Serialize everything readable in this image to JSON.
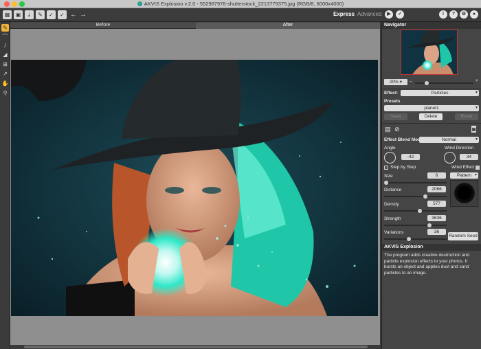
{
  "window": {
    "title": "AKVIS Explosion v.2.0 - 552987976-shutterstock_2213779375.jpg (RGB/8, 6000x4000)"
  },
  "toolbar": {
    "modes": {
      "express": "Express",
      "advanced": "Advanced"
    },
    "help_glyphs": {
      "info": "i",
      "help": "?",
      "settings": "⚙",
      "guide": "●"
    },
    "run_glyph": "▶",
    "apply_glyph": "✓",
    "undo_glyph": "←",
    "redo_glyph": "→"
  },
  "canvas": {
    "before_label": "Before",
    "after_label": "After"
  },
  "navigator": {
    "title": "Navigator",
    "zoom": "20%"
  },
  "settings": {
    "effect_label": "Effect:",
    "effect_value": "Particles",
    "presets_label": "Presets",
    "preset_value": "planet1",
    "save_label": "Save",
    "delete_label": "Delete",
    "reset_label": "Reset",
    "blend_label": "Effect Blend Mode",
    "blend_value": "Normal",
    "angle_label": "Angle",
    "angle_value": "-42",
    "wind_label": "Wind Direction",
    "wind_value": "34",
    "step_label": "Step by Step",
    "wind_effect_label": "Wind Effect",
    "size_label": "Size",
    "size_value": "6",
    "pattern_label": "Pattern",
    "distance_label": "Distance",
    "distance_value": "2066",
    "density_label": "Density",
    "density_value": "577",
    "strength_label": "Strength",
    "strength_value": "3636",
    "variations_label": "Variations",
    "variations_value": "36",
    "random_seed_label": "Random Seed"
  },
  "info": {
    "title": "AKVIS Explosion",
    "text": "The program adds creative destruction and particle explosion effects to your photos. It bursts an object and applies dust and sand particles to an image."
  },
  "colors": {
    "accent": "#f0b43a",
    "teal_glow": "#2ee8c8",
    "panel": "#454545"
  }
}
